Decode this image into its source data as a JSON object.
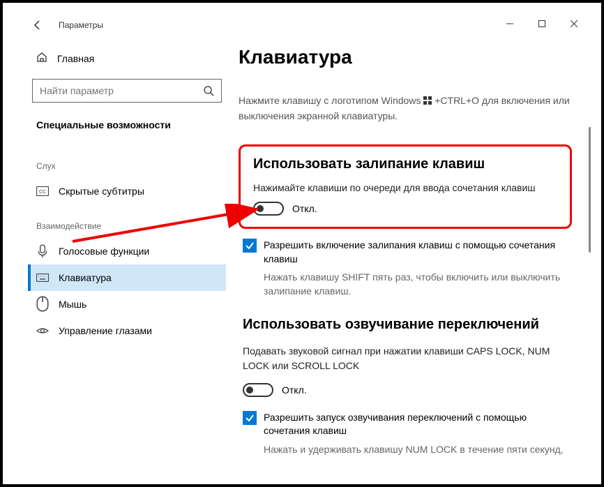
{
  "window": {
    "title": "Параметры",
    "controls": {
      "min": "—",
      "max": "▢",
      "close": "✕"
    }
  },
  "sidebar": {
    "home": "Главная",
    "search_placeholder": "Найти параметр",
    "heading": "Специальные возможности",
    "group_hearing": "Слух",
    "item_cc": "Скрытые субтитры",
    "group_interaction": "Взаимодействие",
    "item_speech": "Голосовые функции",
    "item_keyboard": "Клавиатура",
    "item_mouse": "Мышь",
    "item_eye": "Управление глазами"
  },
  "main": {
    "title": "Клавиатура",
    "onscreen_help_a": "Нажмите клавишу с логотипом Windows",
    "onscreen_help_b": "+CTRL+O для включения или выключения экранной клавиатуры.",
    "sticky": {
      "title": "Использовать залипание клавиш",
      "sub": "Нажимайте клавиши по очереди для ввода сочетания клавиш",
      "toggle_state": "Откл.",
      "cb_label": "Разрешить включение залипания клавиш с помощью сочетания клавиш",
      "cb_help": "Нажать клавишу SHIFT пять раз, чтобы включить или выключить залипание клавиш."
    },
    "togglekeys": {
      "title": "Использовать озвучивание переключений",
      "sub": "Подавать звуковой сигнал при нажатии клавиши CAPS LOCK, NUM LOCK или SCROLL LOCK",
      "toggle_state": "Откл.",
      "cb_label": "Разрешить запуск озвучивания переключений с помощью сочетания клавиш",
      "cb_help": "Нажать и удерживать клавишу NUM LOCK в течение пяти секунд,"
    }
  }
}
